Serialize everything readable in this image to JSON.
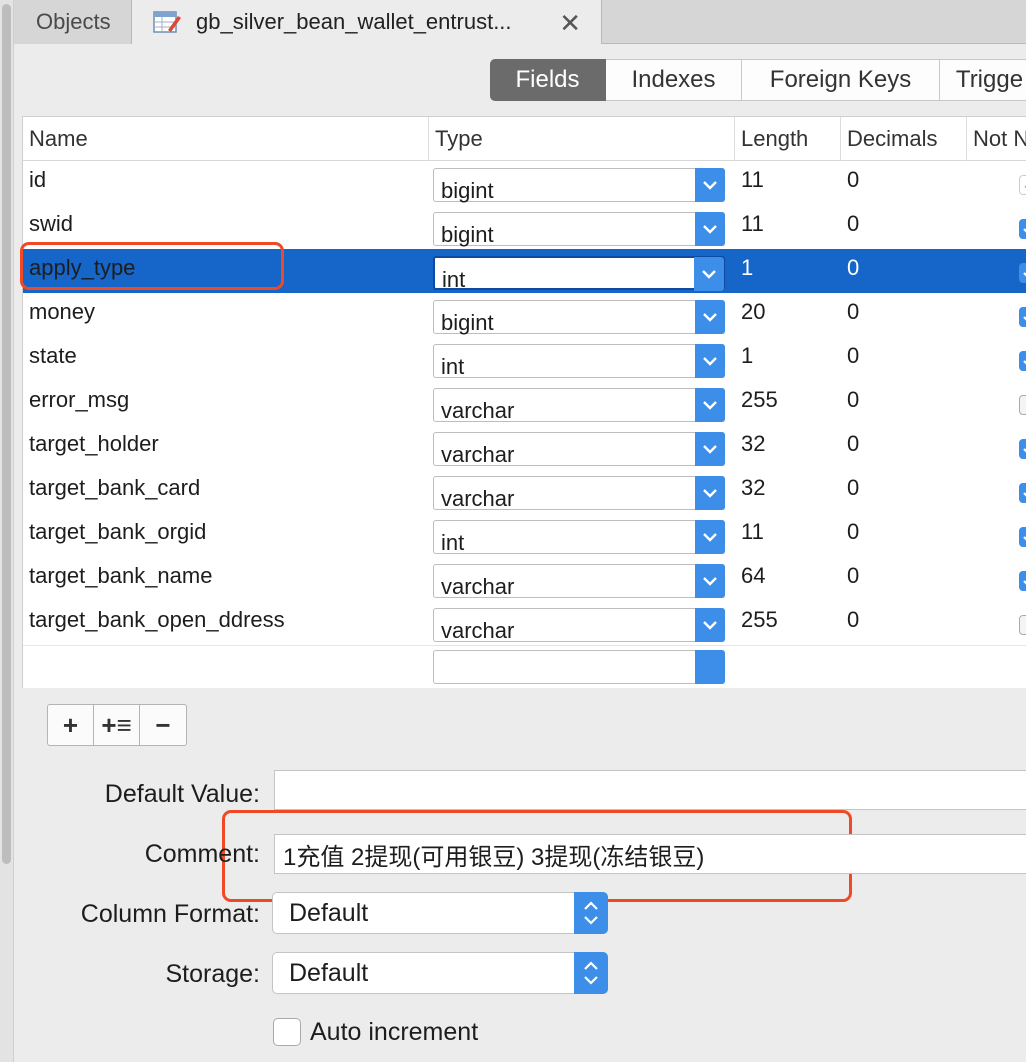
{
  "tabs": {
    "objects": "Objects",
    "table": "gb_silver_bean_wallet_entrust..."
  },
  "segments": {
    "fields": "Fields",
    "indexes": "Indexes",
    "foreign_keys": "Foreign Keys",
    "triggers": "Trigge"
  },
  "columns": {
    "name": "Name",
    "type": "Type",
    "length": "Length",
    "decimals": "Decimals",
    "not_null": "Not N"
  },
  "rows": [
    {
      "name": "id",
      "type": "bigint",
      "length": "11",
      "decimals": "0",
      "not_null": "disabled"
    },
    {
      "name": "swid",
      "type": "bigint",
      "length": "11",
      "decimals": "0",
      "not_null": "checked"
    },
    {
      "name": "apply_type",
      "type": "int",
      "length": "1",
      "decimals": "0",
      "not_null": "checked",
      "selected": true
    },
    {
      "name": "money",
      "type": "bigint",
      "length": "20",
      "decimals": "0",
      "not_null": "checked"
    },
    {
      "name": "state",
      "type": "int",
      "length": "1",
      "decimals": "0",
      "not_null": "checked"
    },
    {
      "name": "error_msg",
      "type": "varchar",
      "length": "255",
      "decimals": "0",
      "not_null": "unchecked"
    },
    {
      "name": "target_holder",
      "type": "varchar",
      "length": "32",
      "decimals": "0",
      "not_null": "checked"
    },
    {
      "name": "target_bank_card",
      "type": "varchar",
      "length": "32",
      "decimals": "0",
      "not_null": "checked"
    },
    {
      "name": "target_bank_orgid",
      "type": "int",
      "length": "11",
      "decimals": "0",
      "not_null": "checked"
    },
    {
      "name": "target_bank_name",
      "type": "varchar",
      "length": "64",
      "decimals": "0",
      "not_null": "checked"
    },
    {
      "name": "target_bank_open_ddress",
      "type": "varchar",
      "length": "255",
      "decimals": "0",
      "not_null": "unchecked"
    }
  ],
  "toolbar": {
    "add": "+",
    "insert": "+≡",
    "remove": "−"
  },
  "form": {
    "default_value_label": "Default Value:",
    "default_value": "",
    "comment_label": "Comment:",
    "comment_value": "1充值  2提现(可用银豆) 3提现(冻结银豆)",
    "column_format_label": "Column Format:",
    "column_format_value": "Default",
    "storage_label": "Storage:",
    "storage_value": "Default",
    "auto_increment_label": "Auto increment"
  },
  "colors": {
    "selection": "#1566c8",
    "accent": "#3d8ee8",
    "annotation": "#ee4a26"
  }
}
